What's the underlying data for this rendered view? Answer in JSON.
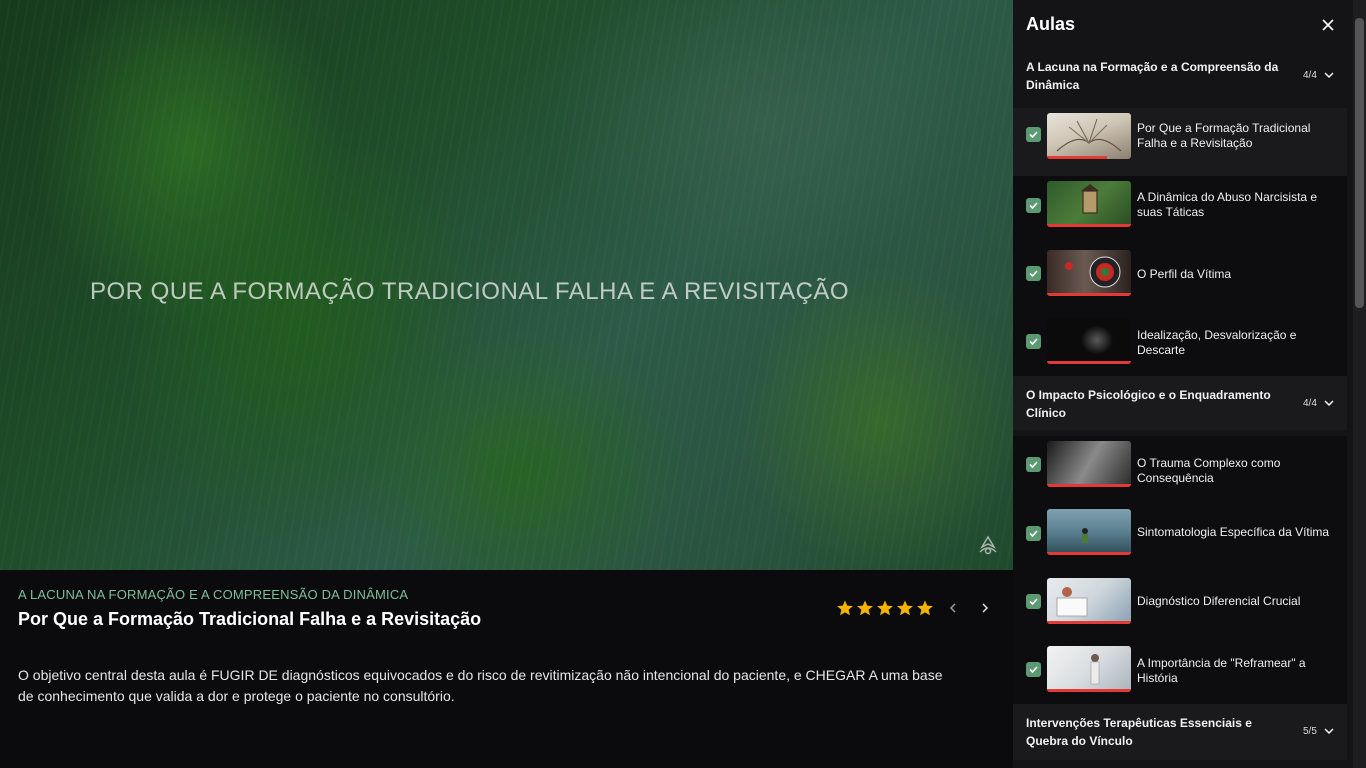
{
  "video": {
    "overlay_title": "POR QUE A FORMAÇÃO TRADICIONAL FALHA E A REVISITAÇÃO"
  },
  "lesson_info": {
    "module_label": "A LACUNA NA FORMAÇÃO E A COMPREENSÃO DA DINÂMICA",
    "title": "Por Que a Formação Tradicional Falha e a Revisitação",
    "rating": 5,
    "rating_max": 5,
    "description": "O objetivo central desta aula é FUGIR DE diagnósticos equivocados e do risco de revitimização não intencional do paciente, e CHEGAR A uma base de conhecimento que valida a dor e protege o paciente no consultório."
  },
  "sidebar": {
    "title": "Aulas",
    "modules": [
      {
        "name": "A Lacuna na Formação e a Compreensão da Dinâmica",
        "count": "4/4",
        "lessons": [
          {
            "name": "Por Que a Formação Tradicional Falha e a Revisitação",
            "completed": true,
            "progress": 0.72,
            "active": true
          },
          {
            "name": "A Dinâmica do Abuso Narcisista e suas Táticas",
            "completed": true,
            "progress": 1.0
          },
          {
            "name": "O Perfil da Vítima",
            "completed": true,
            "progress": 1.0
          },
          {
            "name": "Idealização, Desvalorização e Descarte",
            "completed": true,
            "progress": 1.0
          }
        ]
      },
      {
        "name": "O Impacto Psicológico e o Enquadramento Clínico",
        "count": "4/4",
        "lessons": [
          {
            "name": "O Trauma Complexo como Consequência",
            "completed": true,
            "progress": 1.0
          },
          {
            "name": "Sintomatologia Específica da Vítima",
            "completed": true,
            "progress": 1.0
          },
          {
            "name": "Diagnóstico Diferencial Crucial",
            "completed": true,
            "progress": 1.0
          },
          {
            "name": "A Importância de \"Reframear\" a História",
            "completed": true,
            "progress": 1.0
          }
        ]
      },
      {
        "name": "Intervenções Terapêuticas Essenciais e Quebra do Vínculo",
        "count": "5/5",
        "lessons": []
      }
    ]
  },
  "colors": {
    "accent_green": "#5b9a72",
    "module_label": "#7fbf9a",
    "progress_red": "#e53935",
    "star": "#f5b301"
  }
}
